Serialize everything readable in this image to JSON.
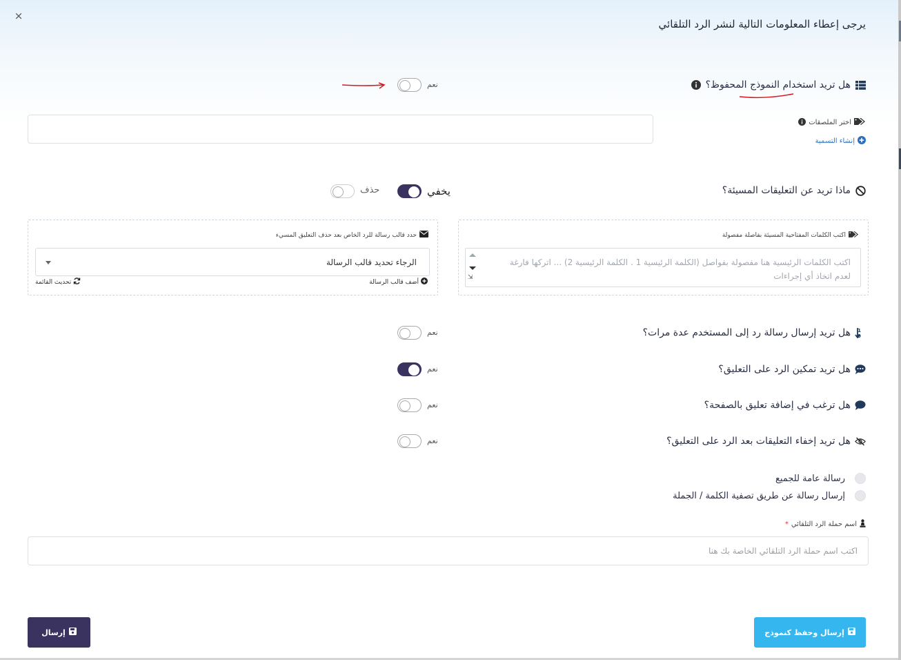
{
  "close_glyph": "×",
  "title": "يرجى إعطاء المعلومات التالية لنشر الرد التلقائي",
  "saved_template": {
    "question": "هل تريد استخدام النموذج المحفوظ؟",
    "toggle_label": "نعم",
    "enabled": false
  },
  "labels_section": {
    "label": "اختر الملصقات",
    "create_link": "إنشاء التسمية"
  },
  "offensive_comments": {
    "question": "ماذا تريد عن التعليقات المسيئة؟",
    "hide_label": "يخفي",
    "hide_enabled": true,
    "delete_label": "حذف",
    "delete_enabled": false
  },
  "keywords": {
    "label": "اكتب الكلمات المفتاحية المسيئة بفاصلة مفصولة",
    "placeholder_line1": "اكتب الكلمات الرئيسية هنا مفصولة بفواصل (الكلمة الرئيسية 1 . الكلمة الرئيسية 2) ... اتركها فارغة",
    "placeholder_line2": "لعدم اتخاذ أي إجراءات"
  },
  "message_template": {
    "label": "حدد قالب رسالة للرد الخاص بعد حذف التعليق المسيء",
    "selected": "الرجاء تحديد قالب الرسالة",
    "add_link": "أضف قالب الرسالة",
    "refresh_link": "تحديث القائمة"
  },
  "questions": [
    {
      "text": "هل تريد إرسال رسالة رد إلى المستخدم عدة مرات؟",
      "toggle_label": "نعم",
      "enabled": false,
      "icon": "sort-numeric-icon"
    },
    {
      "text": "هل تريد تمكين الرد على التعليق؟",
      "toggle_label": "نعم",
      "enabled": true,
      "icon": "comment-dots-icon"
    },
    {
      "text": "هل ترغب في إضافة تعليق بالصفحة؟",
      "toggle_label": "نعم",
      "enabled": false,
      "icon": "comment-icon"
    },
    {
      "text": "هل تريد إخفاء التعليقات بعد الرد على التعليق؟",
      "toggle_label": "نعم",
      "enabled": false,
      "icon": "eye-slash-icon"
    }
  ],
  "message_type": {
    "options": [
      "رسالة عامة للجميع",
      "إرسال رسالة عن طريق تصفية الكلمة / الجملة"
    ]
  },
  "campaign": {
    "label": "اسم حملة الرد التلقائي",
    "required_mark": "*",
    "placeholder": "اكتب اسم حملة الرد التلقائي الخاصة بك هنا"
  },
  "buttons": {
    "submit": "إرسال",
    "submit_save": "إرسال وحفظ كنموذج"
  },
  "colors": {
    "primary_dark": "#3a335f",
    "primary_light": "#36b6ef",
    "link_blue": "#2c6fbf",
    "annotation_red": "#d6191f"
  }
}
